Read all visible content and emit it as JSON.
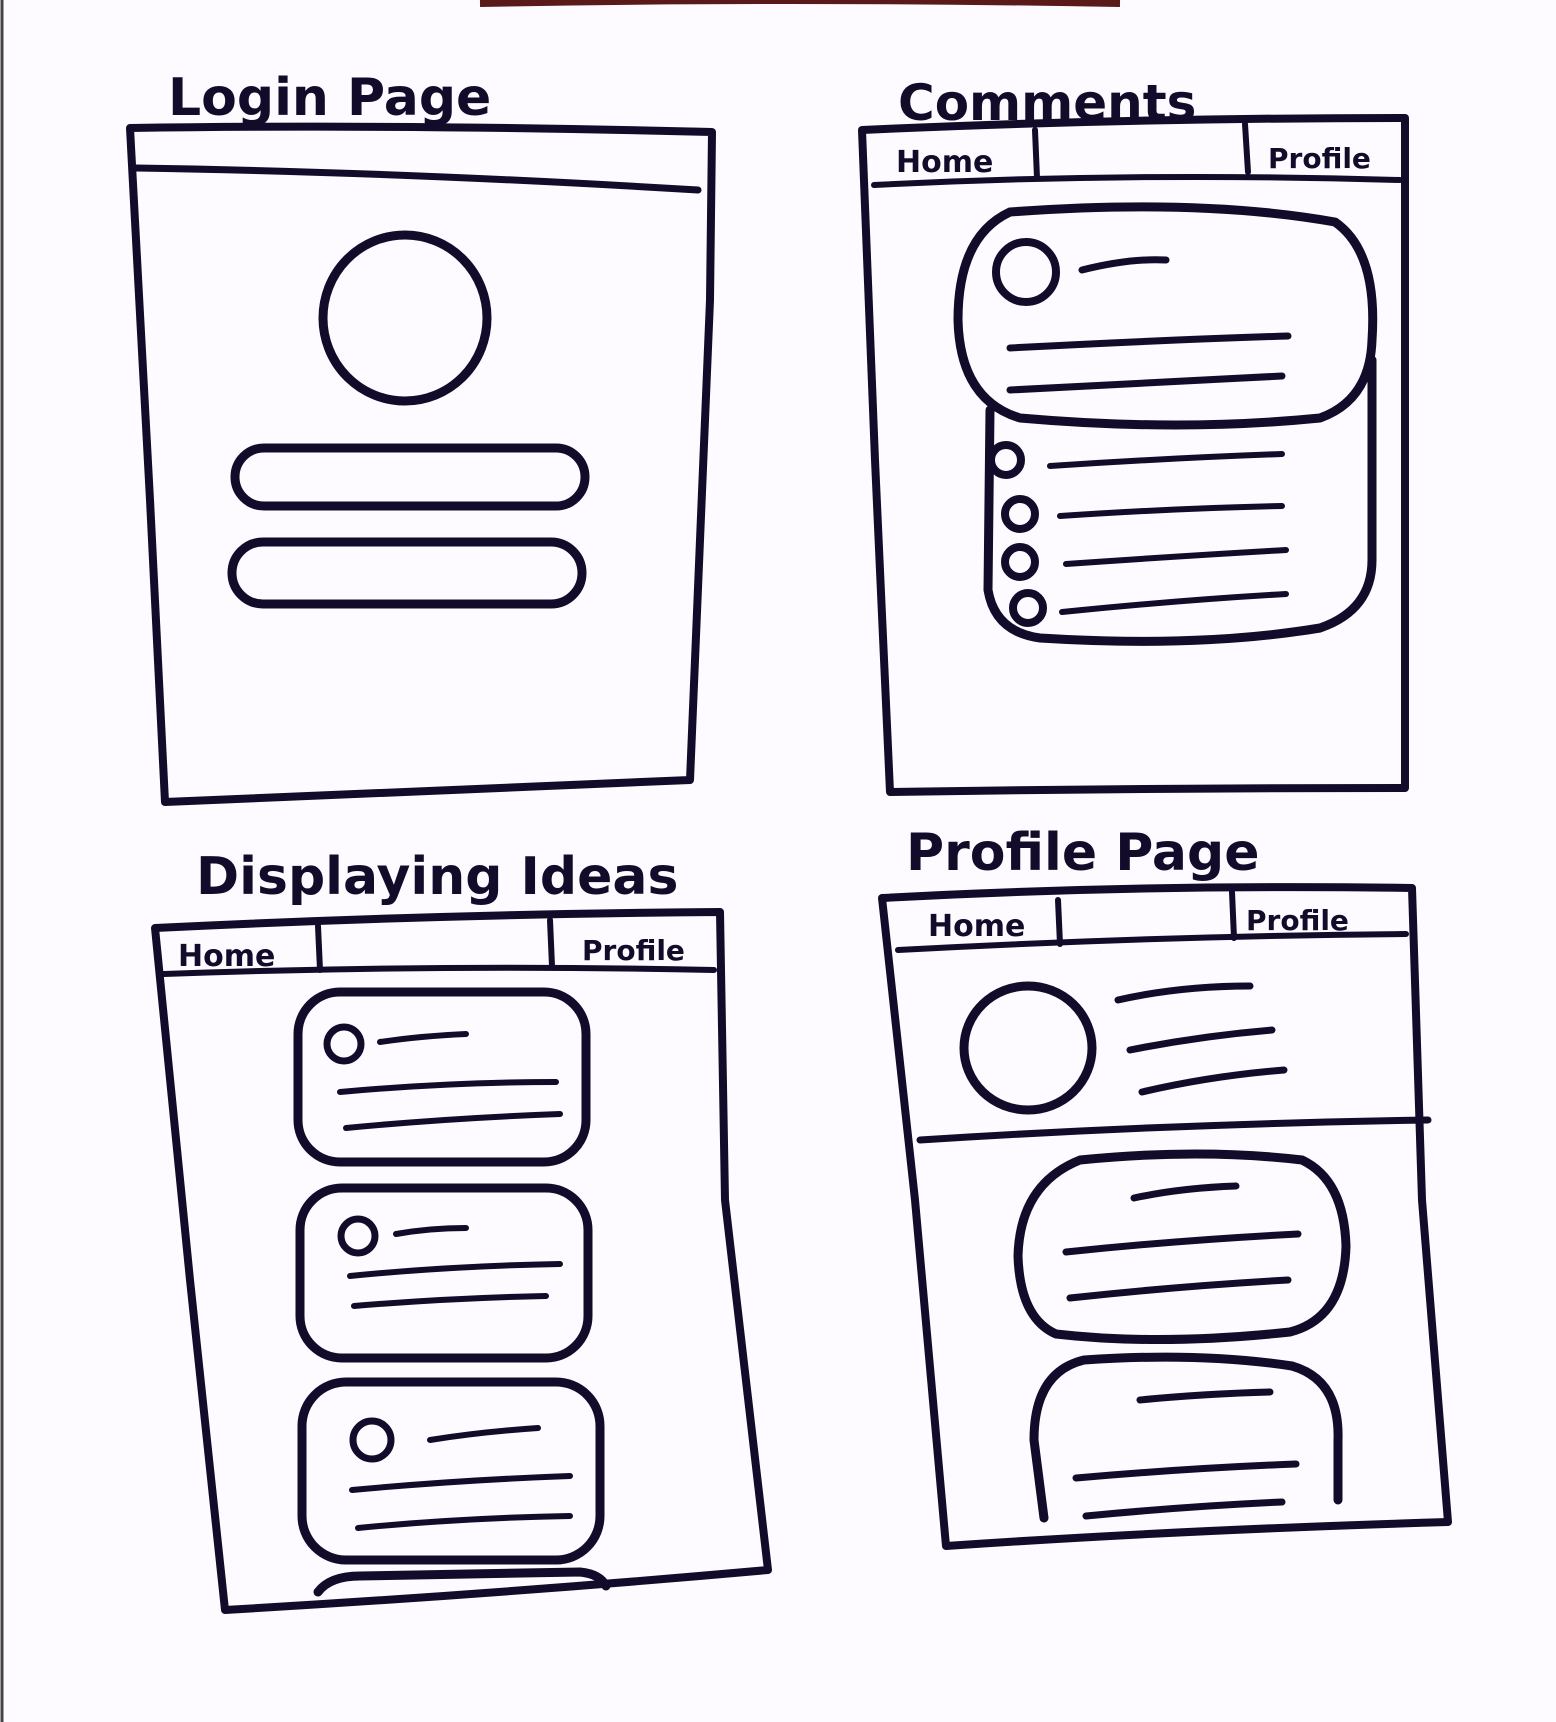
{
  "colors": {
    "ink": "#120c2a",
    "paper": "#fdfbff",
    "top_edge": "#5a1a1a"
  },
  "sketches": {
    "login": {
      "title": "Login Page"
    },
    "comments": {
      "title": "Comments",
      "nav": {
        "home": "Home",
        "profile": "Profile"
      }
    },
    "ideas": {
      "title": "Displaying Ideas",
      "nav": {
        "home": "Home",
        "profile": "Profile"
      }
    },
    "profile": {
      "title": "Profile Page",
      "nav": {
        "home": "Home",
        "profile": "Profile"
      }
    }
  }
}
